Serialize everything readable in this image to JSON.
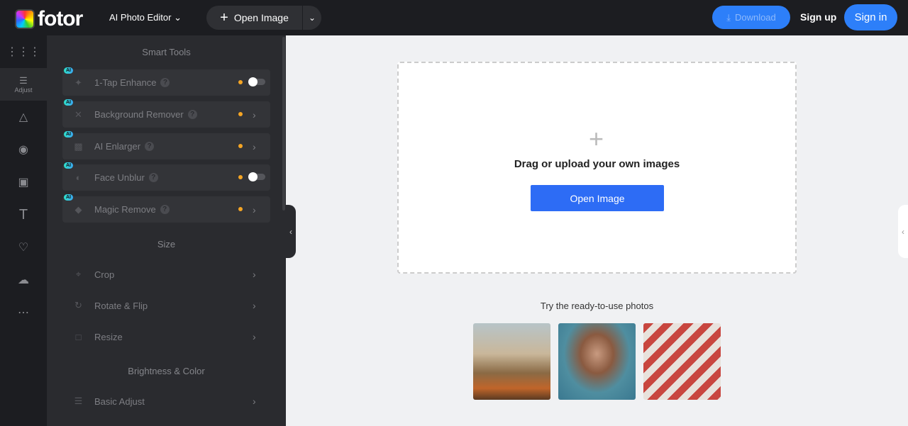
{
  "header": {
    "logo": "fotor",
    "product": "AI Photo Editor",
    "open_image": "Open Image",
    "download": "Download",
    "sign_up": "Sign up",
    "sign_in": "Sign in"
  },
  "rail": {
    "adjust": "Adjust"
  },
  "panel": {
    "smart_tools": "Smart Tools",
    "ai_badge": "AI",
    "tools": [
      {
        "label": "1-Tap Enhance",
        "control": "toggle"
      },
      {
        "label": "Background Remover",
        "control": "chevron"
      },
      {
        "label": "AI Enlarger",
        "control": "chevron"
      },
      {
        "label": "Face Unblur",
        "control": "toggle"
      },
      {
        "label": "Magic Remove",
        "control": "chevron"
      }
    ],
    "size": "Size",
    "size_items": [
      "Crop",
      "Rotate & Flip",
      "Resize"
    ],
    "brightness": "Brightness & Color",
    "brightness_items": [
      "Basic Adjust"
    ]
  },
  "canvas": {
    "drop_text": "Drag or upload your own images",
    "open_button": "Open Image",
    "try_text": "Try the ready-to-use photos"
  },
  "colors": {
    "accent": "#2d7ff9",
    "dot": "#f5a524"
  }
}
